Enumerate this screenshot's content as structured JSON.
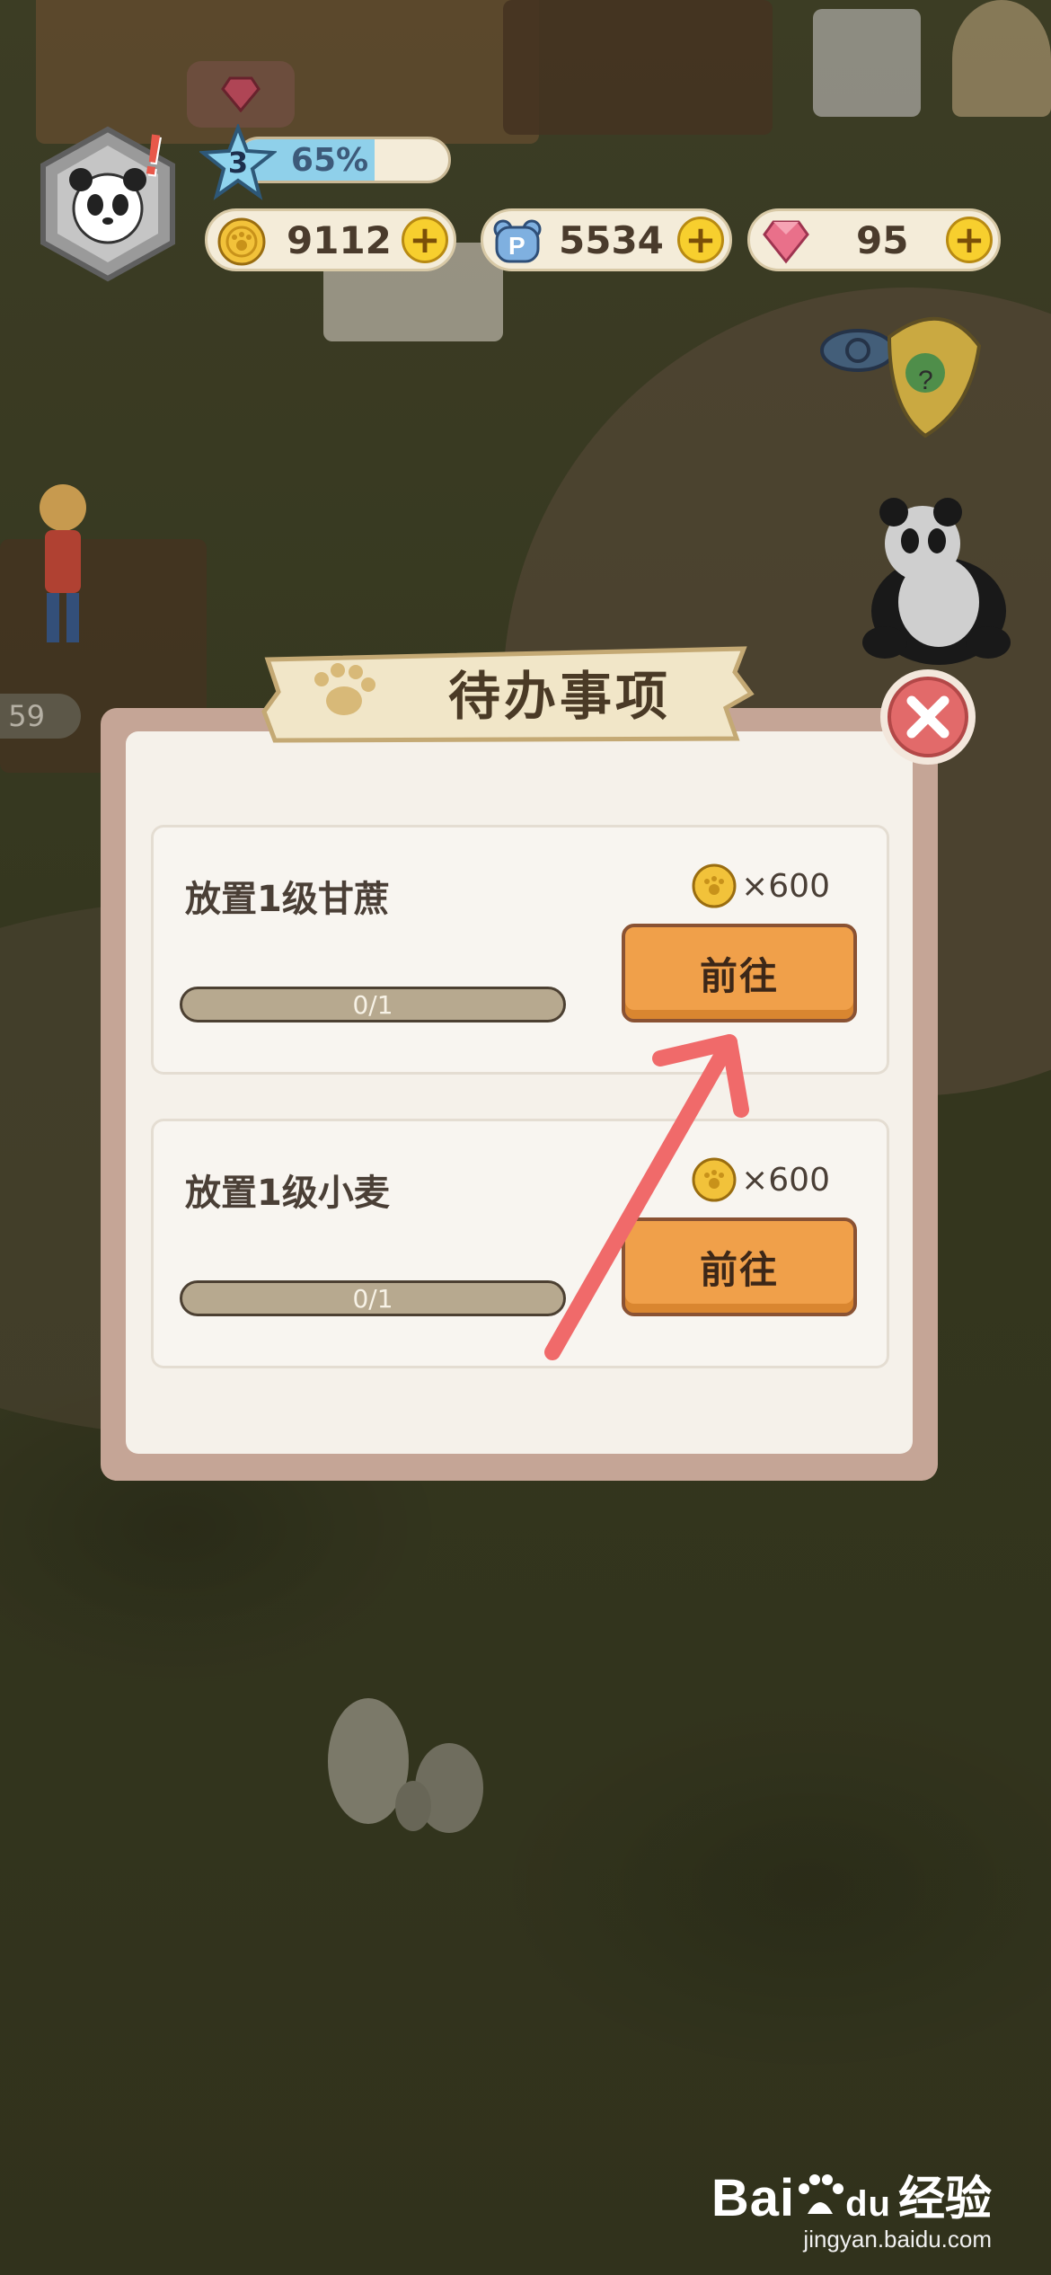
{
  "hud": {
    "level": "3",
    "level_progress_percent": "65%",
    "level_progress_fraction": 0.65,
    "coins": "9112",
    "paw_points": "5534",
    "gems": "95"
  },
  "side_counter": "59",
  "dialog": {
    "title": "待办事项",
    "tasks": [
      {
        "name": "放置1级甘蔗",
        "progress": "0/1",
        "progress_fraction": 0,
        "reward": "×600",
        "button": "前往"
      },
      {
        "name": "放置1级小麦",
        "progress": "0/1",
        "progress_fraction": 0,
        "reward": "×600",
        "button": "前往"
      }
    ]
  },
  "annotation": {
    "color": "#f06a6a"
  },
  "watermark": {
    "brand": "Bai",
    "brand_du": "du",
    "suffix": "经验",
    "url": "jingyan.baidu.com"
  },
  "colors": {
    "accent_orange": "#f0a04a",
    "close_red": "#e26a6a",
    "panel": "#f5f1ea",
    "frame": "#c5a596"
  }
}
